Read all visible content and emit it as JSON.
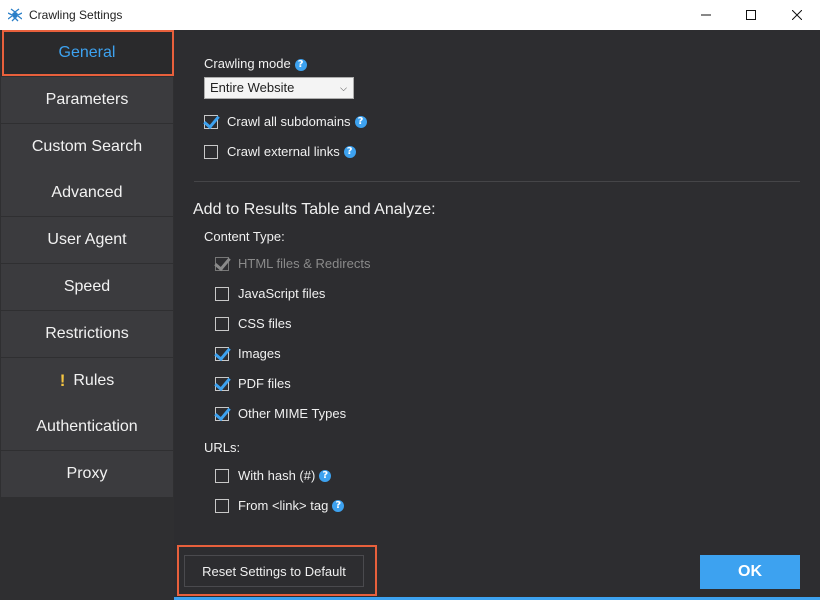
{
  "window": {
    "title": "Crawling Settings",
    "icon": "spider-logo-icon",
    "controls": [
      "minimize-icon",
      "maximize-icon",
      "close-icon"
    ]
  },
  "sidebar": {
    "items": [
      {
        "label": "General",
        "active": true
      },
      {
        "label": "Parameters"
      },
      {
        "label": "Custom Search"
      },
      {
        "label": "Advanced"
      },
      {
        "label": "User Agent"
      },
      {
        "label": "Speed"
      },
      {
        "label": "Restrictions"
      },
      {
        "label": "Rules",
        "warning": "!"
      },
      {
        "label": "Authentication"
      },
      {
        "label": "Proxy"
      }
    ]
  },
  "general": {
    "crawling_mode_label": "Crawling mode",
    "crawling_mode_value": "Entire Website",
    "crawl_subdomains": {
      "label": "Crawl all subdomains",
      "checked": true
    },
    "crawl_external": {
      "label": "Crawl external links",
      "checked": false
    },
    "section_title": "Add to Results Table and Analyze:",
    "content_type_label": "Content Type:",
    "content_types": [
      {
        "label": "HTML files & Redirects",
        "checked": true,
        "disabled": true
      },
      {
        "label": "JavaScript files",
        "checked": false
      },
      {
        "label": "CSS files",
        "checked": false
      },
      {
        "label": "Images",
        "checked": true
      },
      {
        "label": "PDF files",
        "checked": true
      },
      {
        "label": "Other MIME Types",
        "checked": true
      }
    ],
    "urls_label": "URLs:",
    "urls": [
      {
        "label": "With hash (#)",
        "checked": false
      },
      {
        "label": "From <link> tag",
        "checked": false
      }
    ],
    "help_glyph": "?"
  },
  "footer": {
    "reset_label": "Reset Settings to Default",
    "ok_label": "OK"
  },
  "colors": {
    "accent": "#3da2f0",
    "highlight": "#e8603c",
    "sidebar_bg": "#3b3b3e",
    "panel_bg": "#2d2d30"
  }
}
